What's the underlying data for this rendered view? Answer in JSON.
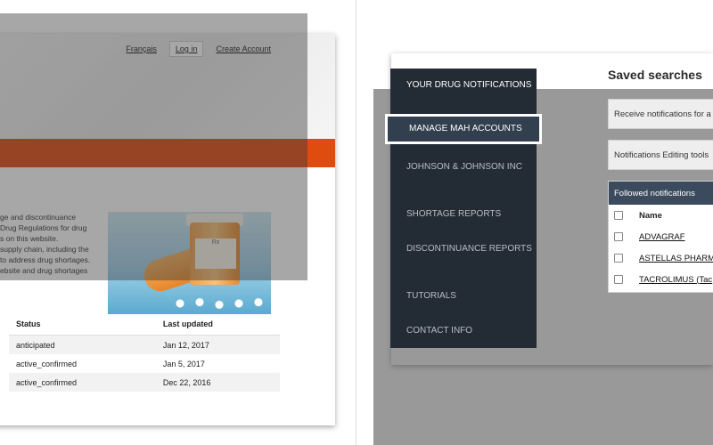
{
  "left": {
    "top_links": {
      "french": "Français",
      "login": "Log in",
      "create_account": "Create Account"
    },
    "intro_lines": [
      "ge and discontinuance",
      "Drug Regulations for drug",
      "s on this website.",
      "supply chain, including the",
      "to address drug shortages.",
      "ebsite and drug shortages"
    ],
    "image_label": "Rx",
    "table": {
      "headers": [
        "Status",
        "Last updated"
      ],
      "rows": [
        [
          "anticipated",
          "Jan 12, 2017"
        ],
        [
          "active_confirmed",
          "Jan 5, 2017"
        ],
        [
          "active_confirmed",
          "Dec 22, 2016"
        ]
      ]
    }
  },
  "right": {
    "sidebar": [
      {
        "label": "YOUR DRUG NOTIFICATIONS"
      },
      {
        "label": "MANAGE MAH ACCOUNTS"
      },
      {
        "label": "JOHNSON & JOHNSON INC"
      },
      {
        "label": "SHORTAGE REPORTS"
      },
      {
        "label": "DISCONTINUANCE REPORTS"
      },
      {
        "label": "TUTORIALS"
      },
      {
        "label": "CONTACT INFO"
      }
    ],
    "saved_searches_title": "Saved searches",
    "receive_box": "Receive notifications for a",
    "editing_box": "Notifications Editing tools",
    "followed": {
      "header": "Followed notifications",
      "col_name": "Name",
      "items": [
        "ADVAGRAF",
        "ASTELLAS PHARM",
        "TACROLIMUS (Tac"
      ]
    }
  },
  "colors": {
    "accent_orange": "#e04c0f",
    "sidebar_bg": "#232b35",
    "sidebar_active": "#323f4e",
    "followed_header": "#3b4a5c"
  }
}
